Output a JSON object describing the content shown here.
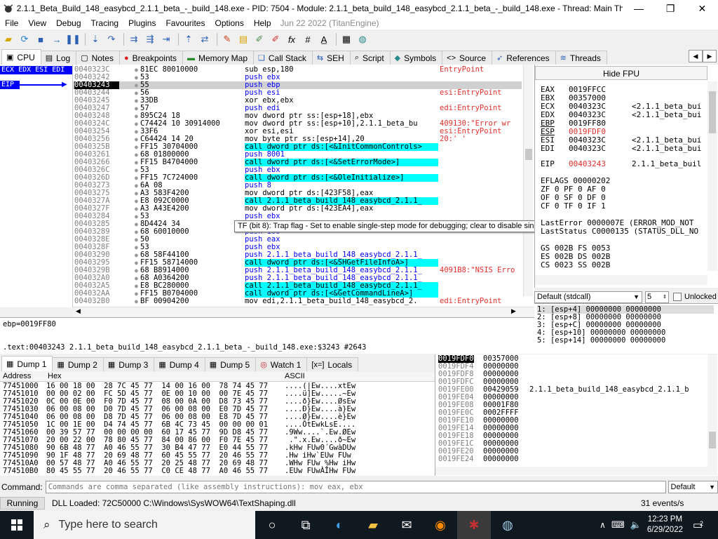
{
  "window": {
    "title": "2.1.1_Beta_Build_148_easybcd_2.1.1_beta_-_build_148.exe - PID: 7504 - Module: 2.1.1_beta_build_148_easybcd_2.1.1_beta_-_build_148.exe - Thread: Main Thread 70...",
    "minimize": "—",
    "maximize": "❐",
    "close": "✕"
  },
  "menu": {
    "items": [
      "File",
      "View",
      "Debug",
      "Tracing",
      "Plugins",
      "Favourites",
      "Options",
      "Help"
    ],
    "info": "Jun 22 2022 (TitanEngine)"
  },
  "tabs": [
    "CPU",
    "Log",
    "Notes",
    "Breakpoints",
    "Memory Map",
    "Call Stack",
    "SEH",
    "Script",
    "Symbols",
    "Source",
    "References",
    "Threads"
  ],
  "regcol": {
    "header": "ECX EDX ESI EDI",
    "eip": "EIP"
  },
  "disasm": [
    {
      "a": "0040323C",
      "b": "81EC 80010000",
      "i": "sub esp,180",
      "c": "EntryPoint"
    },
    {
      "a": "00403242",
      "b": "53",
      "i": "push ebx",
      "c": ""
    },
    {
      "a": "00403243",
      "b": "55",
      "i": "push ebp",
      "c": ""
    },
    {
      "a": "00403244",
      "b": "56",
      "i": "push esi",
      "c": "esi:EntryPoint"
    },
    {
      "a": "00403245",
      "b": "33DB",
      "i": "xor ebx,ebx",
      "c": ""
    },
    {
      "a": "00403247",
      "b": "57",
      "i": "push edi",
      "c": "edi:EntryPoint"
    },
    {
      "a": "00403248",
      "b": "895C24 18",
      "i": "mov dword ptr ss:[esp+18],ebx",
      "c": ""
    },
    {
      "a": "0040324C",
      "b": "C74424 10 30914000",
      "i": "mov dword ptr ss:[esp+10],2.1.1_beta_bu",
      "c": "409130:\"Error wr"
    },
    {
      "a": "00403254",
      "b": "33F6",
      "i": "xor esi,esi",
      "c": "esi:EntryPoint"
    },
    {
      "a": "00403256",
      "b": "C64424 14 20",
      "i": "mov byte ptr ss:[esp+14],20",
      "c": "20:' '"
    },
    {
      "a": "0040325B",
      "b": "FF15 30704000",
      "i": "call dword ptr ds:[<&InitCommonControls>",
      "c": ""
    },
    {
      "a": "00403261",
      "b": "68 01800000",
      "i": "push 8001",
      "c": ""
    },
    {
      "a": "00403266",
      "b": "FF15 B4704000",
      "i": "call dword ptr ds:[<&SetErrorMode>]",
      "c": ""
    },
    {
      "a": "0040326C",
      "b": "53",
      "i": "push ebx",
      "c": ""
    },
    {
      "a": "0040326D",
      "b": "FF15 7C724000",
      "i": "call dword ptr ds:[<&OleInitialize>]",
      "c": ""
    },
    {
      "a": "00403273",
      "b": "6A 08",
      "i": "push 8",
      "c": ""
    },
    {
      "a": "00403275",
      "b": "A3 583F4200",
      "i": "mov dword ptr ds:[423F58],eax",
      "c": ""
    },
    {
      "a": "0040327A",
      "b": "E8 092C0000",
      "i": "call 2.1.1_beta_build_148_easybcd_2.1.1_",
      "c": ""
    },
    {
      "a": "0040327F",
      "b": "A3 A43E4200",
      "i": "mov dword ptr ds:[423EA4],eax",
      "c": ""
    },
    {
      "a": "00403284",
      "b": "53",
      "i": "push ebx",
      "c": ""
    },
    {
      "a": "00403285",
      "b": "8D4424 34",
      "i": "lea eax,dword ptr ss:[esp+34]",
      "c": ""
    },
    {
      "a": "00403289",
      "b": "68 60010000",
      "i": "push 160",
      "c": ""
    },
    {
      "a": "0040328E",
      "b": "50",
      "i": "push eax",
      "c": ""
    },
    {
      "a": "0040328F",
      "b": "53",
      "i": "push ebx",
      "c": ""
    },
    {
      "a": "00403290",
      "b": "68 58F44100",
      "i": "push 2.1.1_beta_build_148_easybcd_2.1.1_",
      "c": ""
    },
    {
      "a": "00403295",
      "b": "FF15 58714000",
      "i": "call dword ptr ds:[<&SHGetFileInfoA>]",
      "c": ""
    },
    {
      "a": "0040329B",
      "b": "68 B8914000",
      "i": "push 2.1.1_beta_build_148_easybcd_2.1.1_",
      "c": "4091B8:\"NSIS Erro"
    },
    {
      "a": "004032A0",
      "b": "68 A0364200",
      "i": "push 2.1.1_beta_build_148_easybcd_2.1.1_",
      "c": ""
    },
    {
      "a": "004032A5",
      "b": "E8 BC280000",
      "i": "call 2.1.1_beta_build_148_easybcd_2.1.1_",
      "c": ""
    },
    {
      "a": "004032AA",
      "b": "FF15 B0704000",
      "i": "call dword ptr ds:[<&GetCommandLineA>]",
      "c": ""
    },
    {
      "a": "004032B0",
      "b": "BF 00904200",
      "i": "mov edi,2.1.1_beta_build_148_easybcd_2.",
      "c": "edi:EntryPoint"
    }
  ],
  "tooltip": "TF (bit 8): Trap flag - Set to enable single-step mode for debugging; clear to disable single-step mode.",
  "fpu": {
    "hide": "Hide FPU",
    "regs": [
      {
        "n": "EAX",
        "v": "0019FFCC",
        "c": ""
      },
      {
        "n": "EBX",
        "v": "00357000",
        "c": ""
      },
      {
        "n": "ECX",
        "v": "0040323C",
        "c": "<2.1.1_beta_bui"
      },
      {
        "n": "EDX",
        "v": "0040323C",
        "c": "<2.1.1_beta_bui"
      },
      {
        "n": "EBP",
        "v": "0019FF80",
        "c": ""
      },
      {
        "n": "ESP",
        "v": "0019FDF0",
        "c": ""
      },
      {
        "n": "ESI",
        "v": "0040323C",
        "c": "<2.1.1_beta_bui"
      },
      {
        "n": "EDI",
        "v": "0040323C",
        "c": "<2.1.1_beta_bui"
      },
      {
        "n": "EIP",
        "v": "00403243",
        "c": "2.1.1_beta_buil"
      }
    ],
    "eflags": "EFLAGS   00000202",
    "flags": [
      "ZF 0  PF 0  AF 0",
      "OF 0  SF 0  DF 0",
      "CF 0  TF 0  IF 1"
    ],
    "lasterr": "LastError  0000007E (ERROR_MOD_NOT",
    "laststatus": "LastStatus C0000135 (STATUS_DLL_NO",
    "seg": [
      "GS 002B  FS 0053",
      "ES 002B  DS 002B",
      "CS 0023  SS 002B"
    ]
  },
  "callconv": {
    "value": "Default (stdcall)",
    "count": "5",
    "unlocked": "Unlocked"
  },
  "stackargs": [
    "1: [esp+4]  00000000 00000000",
    "2: [esp+8]  00000000 00000000",
    "3: [esp+C]  00000000 00000000",
    "4: [esp+10] 00000000 00000000",
    "5: [esp+14] 00000000 00000000"
  ],
  "info": {
    "ebp": "ebp=0019FF80",
    "text": ".text:00403243 2.1.1_beta_build_148_easybcd_2.1.1_beta_-_build_148.exe:$3243 #2643"
  },
  "dumptabs": [
    "Dump 1",
    "Dump 2",
    "Dump 3",
    "Dump 4",
    "Dump 5",
    "Watch 1",
    "Locals"
  ],
  "dumpheaders": {
    "address": "Address",
    "hex": "Hex",
    "ascii": "ASCII"
  },
  "dump": [
    {
      "a": "77451000",
      "h": "16 00 18 00  28 7C 45 77  14 00 16 00  78 74 45 77",
      "s": "....(|Ew....xtEw"
    },
    {
      "a": "77451010",
      "h": "00 00 02 00  FC 5D 45 77  0E 00 10 00  00 7E 45 77",
      "s": "....ü]Ew.....~Ew"
    },
    {
      "a": "77451020",
      "h": "0C 00 0E 00  F0 7D 45 77  08 00 0A 00  D8 73 45 77",
      "s": "....ð}Ew....ØsEw"
    },
    {
      "a": "77451030",
      "h": "06 00 08 00  D0 7D 45 77  06 00 08 00  E0 7D 45 77",
      "s": "....Ð}Ew....à}Ew"
    },
    {
      "a": "77451040",
      "h": "06 00 08 00  D8 7D 45 77  06 00 08 00  E8 7D 45 77",
      "s": "....Ø}Ew....è}Ew"
    },
    {
      "a": "77451050",
      "h": "1C 00 1E 00  D4 74 45 77  6B 4C 73 45  00 00 00 01",
      "s": "....ÔtEwkLsE...."
    },
    {
      "a": "77451060",
      "h": "00 39 57 77  00 00 00 00  60 17 45 77  9D D8 45 77",
      "s": ".9Ww....`.Ew.ØEw"
    },
    {
      "a": "77451070",
      "h": "20 00 22 00  78 80 45 77  84 00 86 00  F0 7E 45 77",
      "s": " .\".x.Ew....ð~Ew"
    },
    {
      "a": "77451080",
      "h": "90 6B 48 77  A0 46 55 77  30 B4 47 77  E0 44 55 77",
      "s": ".kHw FUw0´GwàDUw"
    },
    {
      "a": "77451090",
      "h": "90 1F 48 77  20 69 48 77  60 45 55 77  20 46 55 77",
      "s": ".Hw iHw`EUw FUw"
    },
    {
      "a": "774510A0",
      "h": "00 57 48 77  A0 46 55 77  20 25 48 77  20 69 48 77",
      "s": ".WHw FUw %Hw iHw"
    },
    {
      "a": "774510B0",
      "h": "80 45 55 77  20 46 55 77  C0 CE 48 77  A0 46 55 77",
      "s": ".EUw FUwÀÎHw FUw"
    }
  ],
  "stack2": [
    {
      "a": "0019FDF0",
      "v": "00357000",
      "c": ""
    },
    {
      "a": "0019FDF4",
      "v": "00000000",
      "c": ""
    },
    {
      "a": "0019FDF8",
      "v": "00000000",
      "c": ""
    },
    {
      "a": "0019FDFC",
      "v": "00000000",
      "c": ""
    },
    {
      "a": "0019FE00",
      "v": "00429059",
      "c": "2.1.1_beta_build_148_easybcd_2.1.1_b"
    },
    {
      "a": "0019FE04",
      "v": "00000000",
      "c": ""
    },
    {
      "a": "0019FE08",
      "v": "00001F80",
      "c": ""
    },
    {
      "a": "0019FE0C",
      "v": "0002FFFF",
      "c": ""
    },
    {
      "a": "0019FE10",
      "v": "00000000",
      "c": ""
    },
    {
      "a": "0019FE14",
      "v": "00000000",
      "c": ""
    },
    {
      "a": "0019FE18",
      "v": "00000000",
      "c": ""
    },
    {
      "a": "0019FE1C",
      "v": "00000000",
      "c": ""
    },
    {
      "a": "0019FE20",
      "v": "00000000",
      "c": ""
    },
    {
      "a": "0019FE24",
      "v": "00000000",
      "c": ""
    }
  ],
  "command": {
    "label": "Command:",
    "placeholder": "Commands are comma separated (like assembly instructions): mov eax, ebx",
    "mode": "Default"
  },
  "status": {
    "state": "Running",
    "message": "DLL Loaded: 72C50000 C:\\Windows\\SysWOW64\\TextShaping.dll",
    "events": "31 events/s"
  },
  "taskbar": {
    "search": "Type here to search",
    "time": "12:23 PM",
    "date": "6/29/2022",
    "notif": "2"
  },
  "colors": {
    "accent": "#0000ff",
    "cyan": "#00ffff",
    "yellow": "#ffff00",
    "red": "#e0302b",
    "eip_bg": "#000000"
  }
}
